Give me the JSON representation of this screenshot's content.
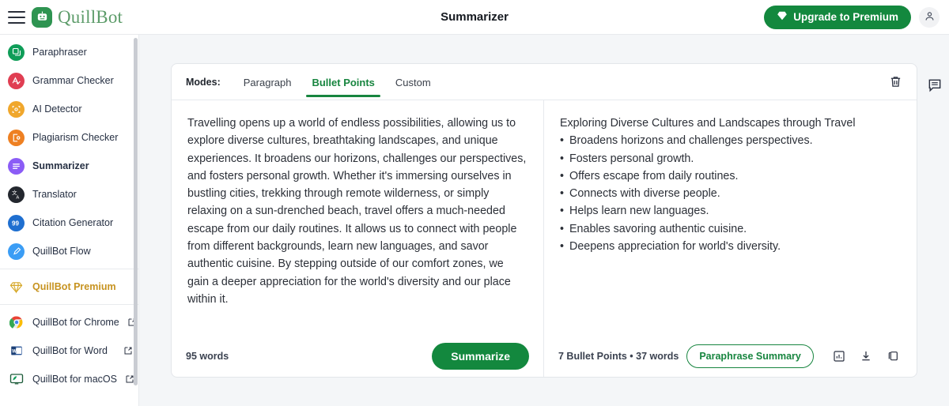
{
  "topbar": {
    "menu_icon": "hamburger-icon",
    "brand": "QuillBot",
    "title": "Summarizer",
    "upgrade_label": "Upgrade to Premium",
    "upgrade_icon": "diamond-icon",
    "account_icon": "user-icon",
    "colors": {
      "green": "#13883e",
      "brand_text": "#5d9c6a"
    }
  },
  "sidebar": {
    "items": [
      {
        "label": "Paraphraser",
        "icon": "paraphraser-icon",
        "color": "#0f9d58",
        "active": false
      },
      {
        "label": "Grammar Checker",
        "icon": "grammar-checker-icon",
        "color": "#e03e52",
        "active": false
      },
      {
        "label": "AI Detector",
        "icon": "ai-detector-icon",
        "color": "#f0a72c",
        "active": false
      },
      {
        "label": "Plagiarism Checker",
        "icon": "plagiarism-checker-icon",
        "color": "#ee8022",
        "active": false
      },
      {
        "label": "Summarizer",
        "icon": "summarizer-icon",
        "color": "#8b5cf6",
        "active": true
      },
      {
        "label": "Translator",
        "icon": "translator-icon",
        "color": "#23272e",
        "active": false
      },
      {
        "label": "Citation Generator",
        "icon": "citation-generator-icon",
        "color": "#1f6fd0",
        "active": false
      },
      {
        "label": "QuillBot Flow",
        "icon": "quillbot-flow-icon",
        "color": "#3b9df5",
        "active": false
      }
    ],
    "premium": {
      "label": "QuillBot Premium",
      "icon": "diamond-outline-icon",
      "color": "#c79320"
    },
    "apps": [
      {
        "label": "QuillBot for Chrome",
        "icon": "chrome-icon",
        "external": "external-link-icon"
      },
      {
        "label": "QuillBot for Word",
        "icon": "ms-word-icon",
        "external": "external-link-icon"
      },
      {
        "label": "QuillBot for macOS",
        "icon": "macos-icon",
        "external": "external-link-icon"
      }
    ]
  },
  "card": {
    "modes_label": "Modes:",
    "tabs": [
      {
        "label": "Paragraph",
        "active": false
      },
      {
        "label": "Bullet Points",
        "active": true
      },
      {
        "label": "Custom",
        "active": false
      }
    ],
    "delete_icon": "trash-icon",
    "feedback_icon": "feedback-comment-icon",
    "input": {
      "text": "Travelling opens up a world of endless possibilities, allowing us to explore diverse cultures, breathtaking landscapes, and unique experiences. It broadens our horizons, challenges our perspectives, and fosters personal growth. Whether it's immersing ourselves in bustling cities, trekking through remote wilderness, or simply relaxing on a sun-drenched beach, travel offers a much-needed escape from our daily routines. It allows us to connect with people from different backgrounds, learn new languages, and savor authentic cuisine. By stepping outside of our comfort zones, we gain a deeper appreciation for the world's diversity and our place within it.",
      "word_count": "95 words",
      "summarize_label": "Summarize"
    },
    "output": {
      "title": "Exploring Diverse Cultures and Landscapes through Travel",
      "bullets": [
        "Broadens horizons and challenges perspectives.",
        "Fosters personal growth.",
        "Offers escape from daily routines.",
        "Connects with diverse people.",
        "Helps learn new languages.",
        "Enables savoring authentic cuisine.",
        "Deepens appreciation for world's diversity."
      ],
      "stats": "7 Bullet Points • 37 words",
      "paraphrase_label": "Paraphrase Summary",
      "icons": [
        "bar-chart-icon",
        "download-icon",
        "copy-icon"
      ]
    }
  }
}
